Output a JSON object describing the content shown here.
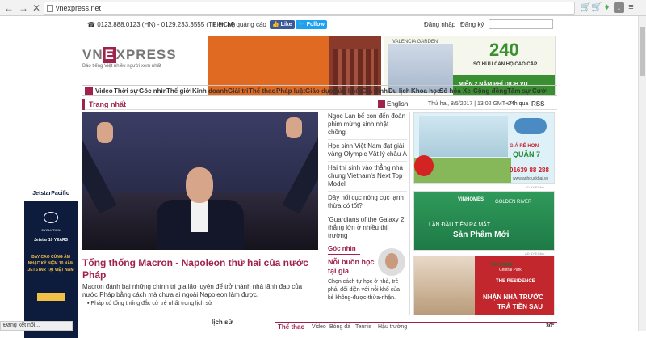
{
  "browser": {
    "url": "vnexpress.net"
  },
  "topbar": {
    "phones": "☎ 0123.888.0123 (HN) - 0129.233.3555 (TP HCM)",
    "contact": "Liên hệ quảng cáo",
    "like": "Like",
    "follow": "Follow",
    "login": "Đăng nhập",
    "register": "Đăng ký"
  },
  "logo": {
    "pre": "VN",
    "e": "E",
    "post": "XPRESS",
    "slogan": "Báo tiếng Việt nhiều người xem nhất"
  },
  "ad_top_right": {
    "brand": "VALENCIA GARDEN",
    "number": "240",
    "unit": "TRIỆU ĐỒNG",
    "line1": "SỞ HỮU CĂN HỘ CAO CẤP",
    "line2": "MIỄN 2 NĂM PHÍ DỊCH VỤ"
  },
  "nav": {
    "items": [
      "Video",
      "Thời sự",
      "Góc nhìn",
      "Thế giới",
      "Kinh doanh",
      "Giải trí",
      "Thể thao",
      "Pháp luật",
      "Giáo dục",
      "Sức khỏe",
      "Gia đình",
      "Du lịch",
      "Khoa học",
      "Số hóa",
      "Xe",
      "Cộng đồng",
      "Tâm sự",
      "Cười"
    ]
  },
  "section": {
    "title": "Trang nhất",
    "english": "English",
    "date": "Thứ hai, 8/5/2017 | 13:02 GMT+7",
    "h24": "24h qua",
    "rss": "RSS"
  },
  "main": {
    "headline": "Tổng thống Macron - Napoleon thứ hai của nước Pháp",
    "summary": "Macron đánh bại những chính trị gia lão luyện để trở thành nhà lãnh đạo của nước Pháp bằng cách mà chưa ai ngoài Napoleon làm được.",
    "related": "▪ Pháp có tổng thống đắc cử trẻ nhất trong lịch sử"
  },
  "news": [
    "Ngọc Lan bế con đến đoàn phim mừng sinh nhật chồng",
    "Học sinh Việt Nam đạt giải vàng Olympic Vật lý châu Á",
    "Hai thí sinh vào thẳng nhà chung Vietnam's Next Top Model",
    "Dây nối cục nóng cục lạnh thừa có tốt?",
    "'Guardians of the Galaxy 2' thắng lớn ở nhiều thị trường"
  ],
  "opinion": {
    "label": "Góc nhìn",
    "title": "Nỗi buồn học tại gia",
    "body": "Chọn cách tự học ở nhà, trẻ phải đối diện với nỗi khổ của kẻ không-được-thừa-nhận."
  },
  "ad_r1": {
    "t1": "GIÁ RẺ HƠN",
    "t2": "QUẬN 7",
    "t3": "01639 88 288",
    "t4": "www.anhduckhai.vn"
  },
  "ad_r2": {
    "brand": "VINHOMES",
    "brand2": "GOLDEN RIVER",
    "t1": "LẦN ĐẦU TIÊN RA MẮT",
    "t2": "Sản Phẩm Mới"
  },
  "ad_r3": {
    "brand": "VINHOMES",
    "brand2": "Central Park",
    "t1": "THE RESIDENCE",
    "t2": "NHẬN NHÀ TRƯỚC",
    "t3": "TRẢ TIỀN SAU"
  },
  "ad_label": "AD BY EClick",
  "left_ad": {
    "brand": "JetstarPacific",
    "sub": "EVOLUTION",
    "j": "Jetstar 10 YEARS",
    "big": "BAY CAO CÙNG ÂM NHẠC KỶ NIỆM 10 NĂM JETSTAR TẠI VIỆT NAM"
  },
  "bottom": {
    "lichsu": "lịch sử",
    "title": "Thể thao",
    "tabs": [
      "Video",
      "Bóng đá",
      "Tennis",
      "Hậu trường"
    ],
    "right": "30°"
  },
  "status": "Đang kết nối..."
}
